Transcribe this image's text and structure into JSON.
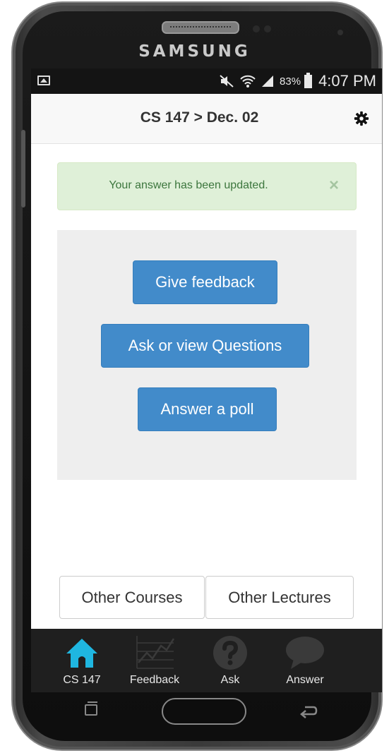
{
  "device": {
    "brand": "SAMSUNG"
  },
  "status_bar": {
    "battery_percent": "83%",
    "time": "4:07 PM"
  },
  "header": {
    "title": "CS 147 > Dec. 02"
  },
  "alert": {
    "message": "Your answer has been updated.",
    "close": "×"
  },
  "actions": {
    "give_feedback": "Give feedback",
    "ask_questions": "Ask or view Questions",
    "answer_poll": "Answer a poll"
  },
  "navigation": {
    "other_courses": "Other Courses",
    "other_lectures": "Other Lectures"
  },
  "tabs": [
    {
      "label": "CS 147",
      "icon": "home-icon",
      "active": true,
      "color": "#1fb6e0"
    },
    {
      "label": "Feedback",
      "icon": "chart-icon",
      "active": false,
      "color": "#3a3a3a"
    },
    {
      "label": "Ask",
      "icon": "question-icon",
      "active": false,
      "color": "#3a3a3a"
    },
    {
      "label": "Answer",
      "icon": "speech-bubble-icon",
      "active": false,
      "color": "#3a3a3a"
    }
  ],
  "colors": {
    "primary": "#428bca",
    "success_bg": "#dff0d8",
    "success_text": "#3c763d",
    "tab_active": "#1fb6e0"
  }
}
